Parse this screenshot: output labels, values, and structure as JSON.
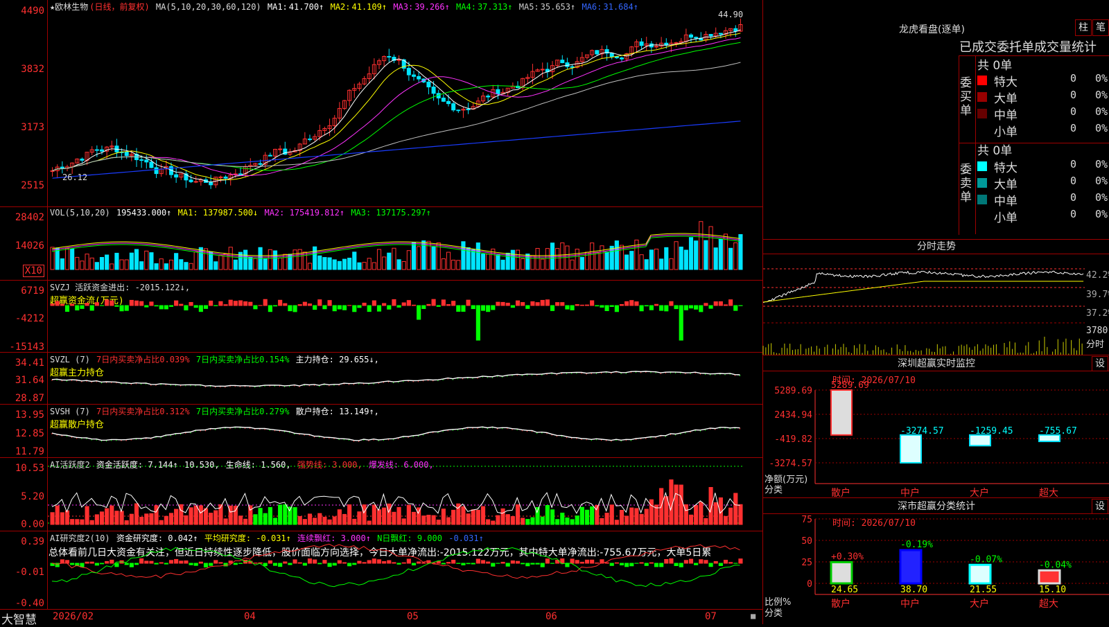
{
  "colors": {
    "up": "#ff3030",
    "down": "#00e5ff",
    "ma1": "#ffffff",
    "ma2": "#ffff00",
    "ma3": "#ff33ff",
    "ma4": "#00ff00",
    "ma5": "#c0c0c0",
    "ma6": "#1a3cff"
  },
  "kline": {
    "stock": "★欧林生物",
    "mode": "(日线，前复权)",
    "params": "MA(5,10,20,30,60,120)",
    "ma": [
      {
        "label": "MA1:",
        "value": "41.700↑"
      },
      {
        "label": "MA2:",
        "value": "41.109↑"
      },
      {
        "label": "MA3:",
        "value": "39.266↑"
      },
      {
        "label": "MA4:",
        "value": "37.313↑"
      },
      {
        "label": "MA5:",
        "value": "35.653↑"
      },
      {
        "label": "MA6:",
        "value": "31.684↑"
      }
    ],
    "y_ticks": [
      "4490",
      "3832",
      "3173",
      "2515"
    ],
    "high_label": "44.90",
    "low_label": "26.12"
  },
  "vol": {
    "title": "VOL(5,10,20)",
    "value": "195433.000↑",
    "ma1": "MA1: 137987.500↓",
    "ma2": "MA2: 175419.812↑",
    "ma3": "MA3: 137175.297↑",
    "y_ticks": [
      "28402",
      "14026"
    ],
    "unit": "X10"
  },
  "svzj": {
    "title": "SVZJ  活跃资金进出: -2015.122↓,",
    "sub": "超赢资金流(万元)",
    "y_ticks": [
      "6719",
      "-4212",
      "-15143"
    ]
  },
  "svzl": {
    "title": "SVZL (7)",
    "t1": "7日内买卖净占比0.039%",
    "t2": "7日内买卖净占比0.154%",
    "t3": "主力持仓: 29.655↓,",
    "sub": "超赢主力持仓",
    "y_ticks": [
      "34.41",
      "31.64",
      "28.87"
    ]
  },
  "svsh": {
    "title": "SVSH (7)",
    "t1": "7日内买卖净占比0.312%",
    "t2": "7日内买卖净占比0.279%",
    "t3": "散户持仓: 13.149↑,",
    "sub": "超赢散户持仓",
    "y_ticks": [
      "13.95",
      "12.85",
      "11.79"
    ]
  },
  "ai1": {
    "title": "AI活跃度2",
    "t1": "资金活跃度: 7.144↑",
    "t2": "10.530,",
    "t3": "生命线: 1.560,",
    "t4": "强势线: 3.000,",
    "t5": "爆发线: 6.000,",
    "y_ticks": [
      "10.53",
      "5.20",
      "0.00"
    ]
  },
  "ai2": {
    "title": "AI研究度2(10)",
    "t1": "资金研究度: 0.042↑",
    "t2": "平均研究度: -0.031↑",
    "t3": "连续飘红: 3.000↑",
    "t4": "N日飘红: 9.000",
    "t5": "-0.031↑",
    "summary": "总体看前几日大资金有关注，但近日持续性逐步降低，股价面临方向选择，今日大单净流出:-2015.122万元，其中特大单净流出:-755.67万元，大单5日累",
    "y_ticks": [
      "0.39",
      "-0.01",
      "-0.40"
    ]
  },
  "xaxis": {
    "brand": "大智慧",
    "labels": [
      "2026/02",
      "04",
      "05",
      "06",
      "07"
    ]
  },
  "longhu": {
    "title": "龙虎看盘(逐单)",
    "btn_zhu": "柱",
    "btn_bi": "笔",
    "subtitle": "已成交委托单成交量统计",
    "buy_side": "委买单",
    "sell_side": "委卖单",
    "buy_total": "共 0单",
    "sell_total": "共 0单",
    "buy_rows": [
      {
        "name": "特大",
        "count": "0",
        "pct": "0%",
        "color": "#ff0000"
      },
      {
        "name": "大单",
        "count": "0",
        "pct": "0%",
        "color": "#990000"
      },
      {
        "name": "中单",
        "count": "0",
        "pct": "0%",
        "color": "#660000"
      },
      {
        "name": "小单",
        "count": "0",
        "pct": "0%",
        "color": "#000000"
      }
    ],
    "sell_rows": [
      {
        "name": "特大",
        "count": "0",
        "pct": "0%",
        "color": "#00ffff"
      },
      {
        "name": "大单",
        "count": "0",
        "pct": "0%",
        "color": "#009999"
      },
      {
        "name": "中单",
        "count": "0",
        "pct": "0%",
        "color": "#007777"
      },
      {
        "name": "小单",
        "count": "0",
        "pct": "0%",
        "color": "#000000"
      }
    ]
  },
  "fenshi": {
    "title": "分时走势",
    "y_ticks": [
      "42.2%",
      "39.7%",
      "37.2%"
    ],
    "vol_tick": "3780",
    "vol_unit": "分时"
  },
  "monitor": {
    "title": "深圳超赢实时监控",
    "btn": "设",
    "time": "时间: 2026/07/10",
    "y_ticks": [
      "5289.69",
      "2434.94",
      "-419.82",
      "-3274.57"
    ],
    "unit1": "净额(万元)",
    "unit2": "分类",
    "bars": [
      {
        "cat": "散户",
        "value": 5289.69,
        "label": "5289.69"
      },
      {
        "cat": "中户",
        "value": -3274.57,
        "label": "-3274.57"
      },
      {
        "cat": "大户",
        "value": -1259.45,
        "label": "-1259.45"
      },
      {
        "cat": "超大",
        "value": -755.67,
        "label": "-755.67"
      }
    ]
  },
  "classify": {
    "title": "深市超赢分类统计",
    "btn": "设",
    "time": "时间: 2026/07/10",
    "y_ticks": [
      "75",
      "50",
      "25",
      "0"
    ],
    "unit1": "比例%",
    "unit2": "分类",
    "bars": [
      {
        "cat": "散户",
        "value": 24.65,
        "label": "24.65",
        "chg": "+0.30%"
      },
      {
        "cat": "中户",
        "value": 38.7,
        "label": "38.70",
        "chg": "-0.19%"
      },
      {
        "cat": "大户",
        "value": 21.55,
        "label": "21.55",
        "chg": "-0.07%"
      },
      {
        "cat": "超大",
        "value": 15.1,
        "label": "15.10",
        "chg": "-0.04%"
      }
    ]
  },
  "chart_data": [
    {
      "type": "bar",
      "title": "深圳超赢实时监控",
      "categories": [
        "散户",
        "中户",
        "大户",
        "超大"
      ],
      "values": [
        5289.69,
        -3274.57,
        -1259.45,
        -755.67
      ],
      "ylabel": "净额(万元)",
      "xlabel": "分类",
      "ylim": [
        -3274.57,
        5289.69
      ]
    },
    {
      "type": "bar",
      "title": "深市超赢分类统计",
      "categories": [
        "散户",
        "中户",
        "大户",
        "超大"
      ],
      "values": [
        24.65,
        38.7,
        21.55,
        15.1
      ],
      "ylabel": "比例%",
      "xlabel": "分类",
      "ylim": [
        0,
        75
      ]
    }
  ]
}
